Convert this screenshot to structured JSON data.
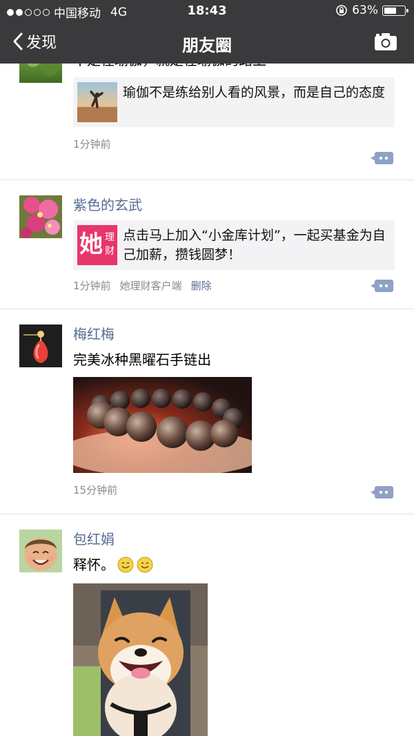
{
  "status_bar": {
    "carrier": "中国移动",
    "network": "4G",
    "time": "18:43",
    "battery": "63%",
    "battery_level": 0.63,
    "signal_dots": [
      true,
      true,
      false,
      false,
      false
    ]
  },
  "nav": {
    "back_label": "发现",
    "title": "朋友圈",
    "camera_icon": "camera-icon"
  },
  "posts": [
    {
      "text": "不是在瑜伽，就是在瑜伽的路上",
      "share_text": "瑜伽不是练给别人看的风景，而是自己的态度",
      "time": "1分钟前"
    },
    {
      "name": "紫色的玄武",
      "share_text": "点击马上加入“小金库计划”，一起买基金为自己加薪，攒钱圆梦！",
      "share_logo": {
        "big": "她",
        "small_top": "理",
        "small_bottom": "财"
      },
      "time": "1分钟前",
      "source": "她理财客户端",
      "delete_label": "删除"
    },
    {
      "name": "梅红梅",
      "text": "完美冰种黑曜石手链出",
      "time": "15分钟前"
    },
    {
      "name": "包红娟",
      "text": "释怀。",
      "emojis": [
        "smile-emoji",
        "smile-emoji"
      ]
    }
  ],
  "colors": {
    "nav_bg": "#3a3a3d",
    "name_blue": "#576b95",
    "comment_button": "#8fa1c4",
    "share_bg": "#f3f3f5",
    "logo_pink": "#e8356c"
  }
}
